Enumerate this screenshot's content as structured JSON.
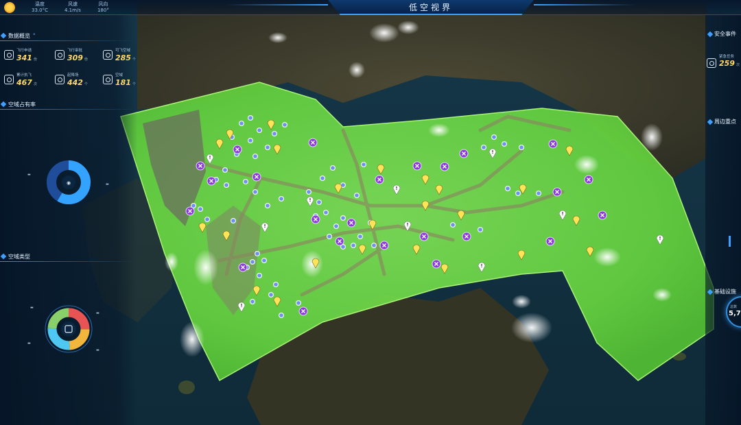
{
  "header": {
    "title": "低空视界",
    "weather": [
      {
        "label": "温度",
        "value": "33.0°C"
      },
      {
        "label": "风速",
        "value": "4.1m/s"
      },
      {
        "label": "风向",
        "value": "180°"
      }
    ]
  },
  "left_panel": {
    "data_overview": {
      "title": "数据概览",
      "stats": [
        {
          "label": "飞行申请",
          "value": "341",
          "unit": "份"
        },
        {
          "label": "飞行审批",
          "value": "309",
          "unit": "份"
        },
        {
          "label": "可飞空域",
          "value": "285",
          "unit": "个"
        },
        {
          "label": "累计执飞",
          "value": "467",
          "unit": "次"
        },
        {
          "label": "起降场",
          "value": "442",
          "unit": "个"
        },
        {
          "label": "空域",
          "value": "181",
          "unit": "个"
        }
      ]
    },
    "airspace_occupancy": {
      "title": "空域占有率"
    },
    "airspace_type": {
      "title": "空域类型"
    }
  },
  "right_panel": {
    "safety": {
      "title": "安全事件",
      "stat_label": "紧急任务",
      "stat_value": "259",
      "stat_unit": "次"
    },
    "section2": {
      "title": "周边重点"
    },
    "infra": {
      "title": "基础设施",
      "gauge_label": "总数",
      "gauge_value": "5,7"
    }
  },
  "map_markers": {
    "purple": "#8c3ad6",
    "yellow": "#ffe45a",
    "blue": "#6f8ff0",
    "white": "#ffffff"
  },
  "overlay_color": "#6fe34a"
}
